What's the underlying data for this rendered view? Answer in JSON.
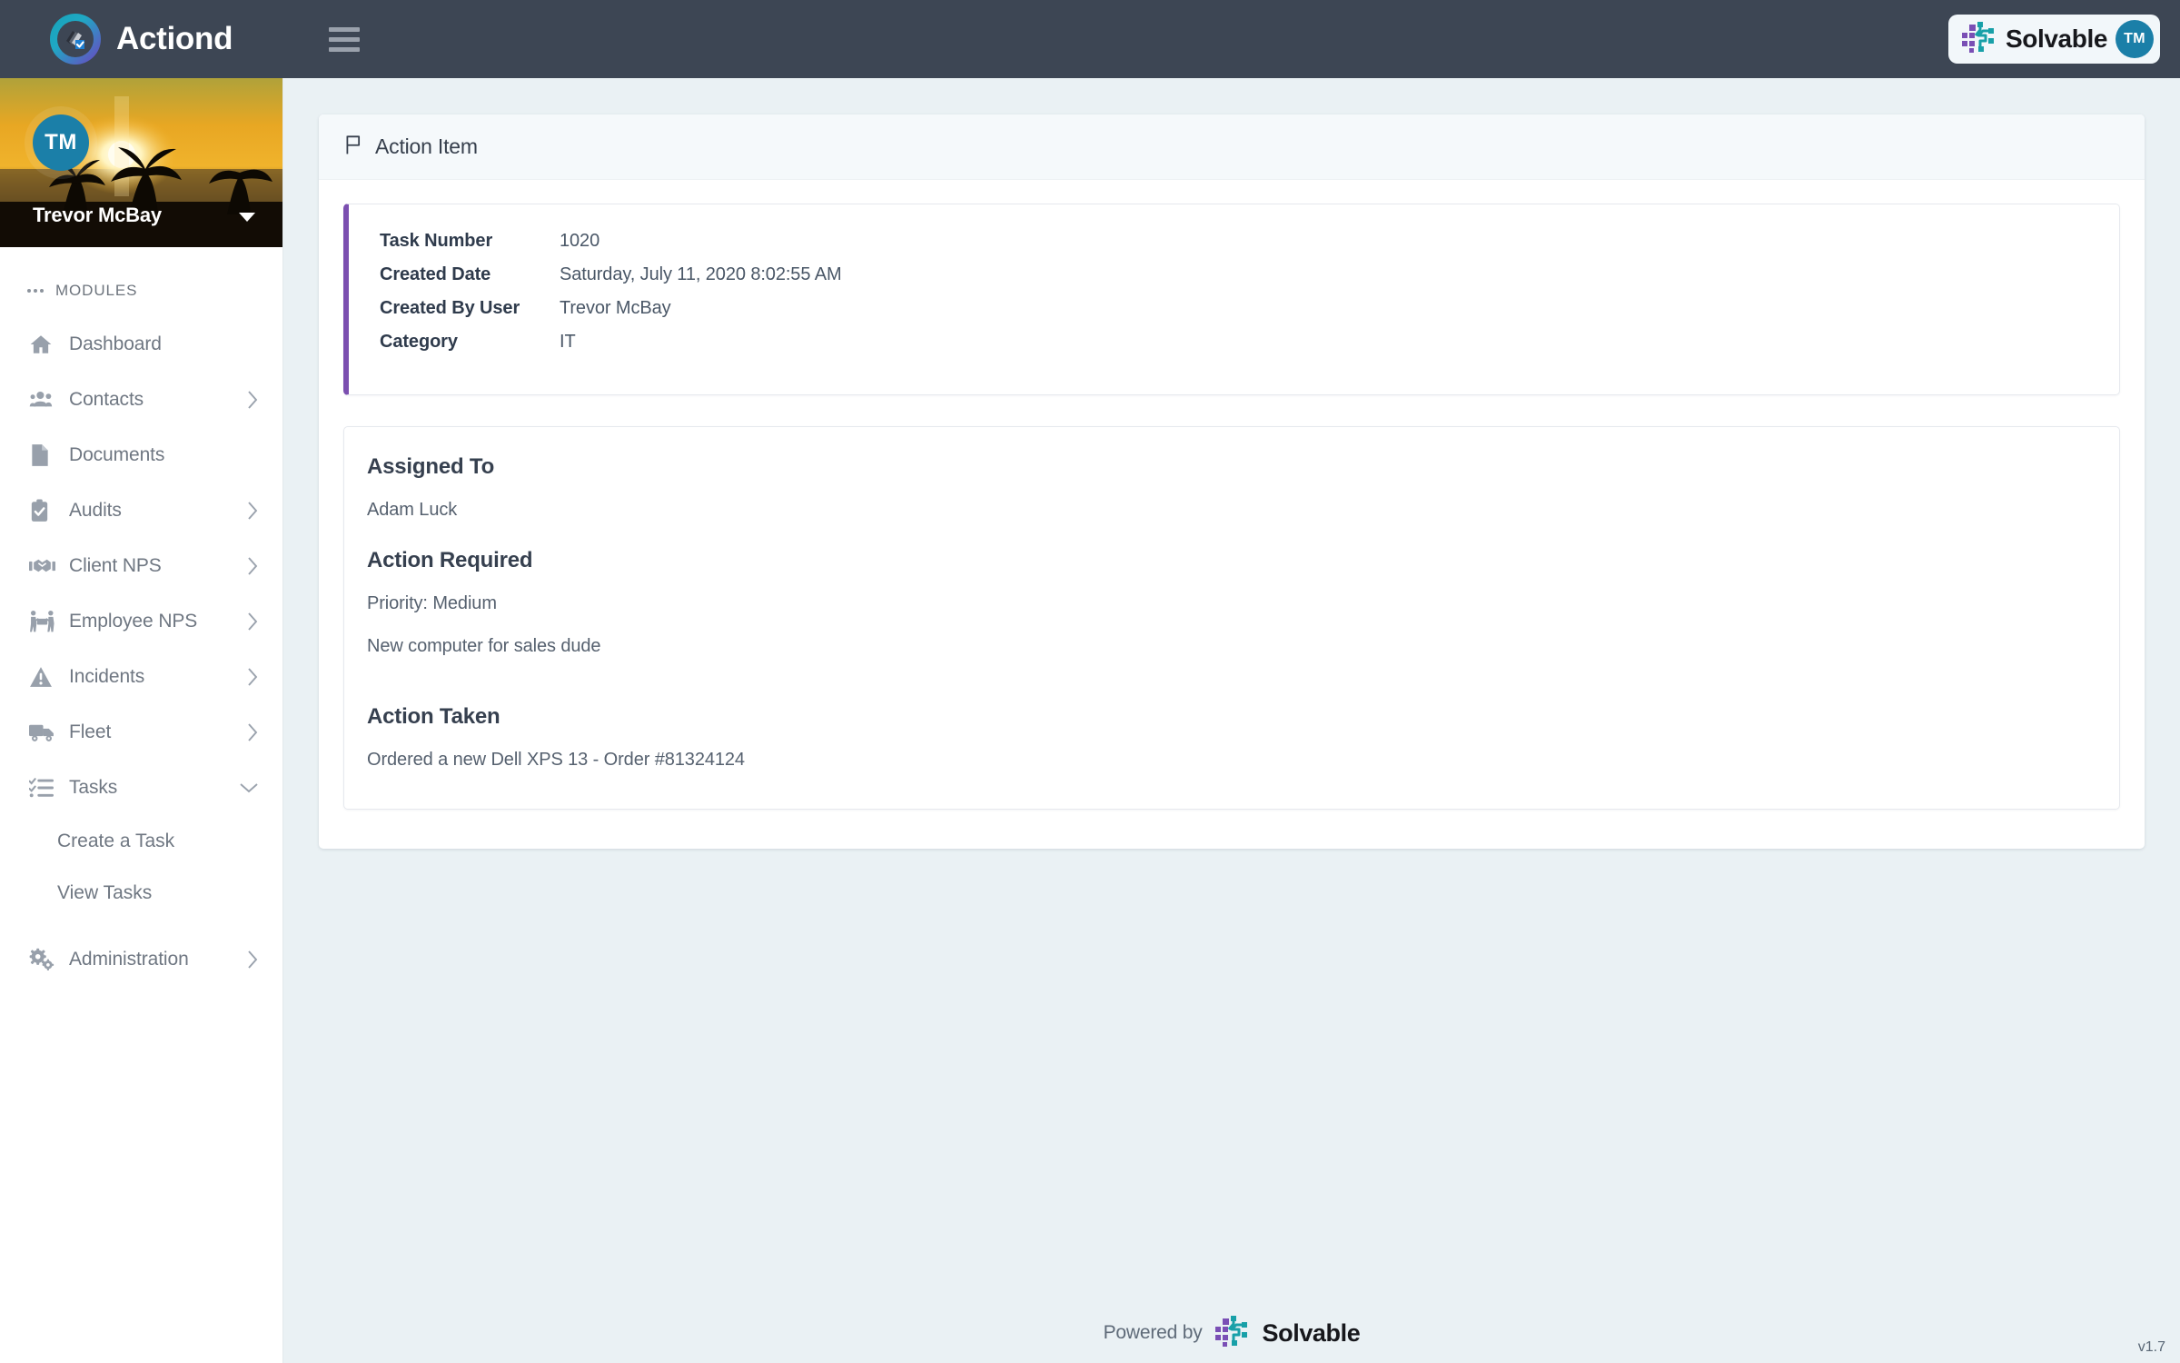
{
  "topbar": {
    "brand_name": "Actiond",
    "brand_logo_icon": "actiond-stacked-pages-check-logo",
    "menu_toggle_icon": "hamburger-menu-icon",
    "solvable": {
      "word": "Solvable",
      "logo_icon": "solvable-node-grid-logo",
      "tm_badge": "TM"
    }
  },
  "sidebar": {
    "profile": {
      "avatar_initials": "TM",
      "name": "Trevor McBay",
      "caret_icon": "caret-down-icon"
    },
    "section_label": "MODULES",
    "section_dots_icon": "ellipsis-icon",
    "items": [
      {
        "label": "Dashboard",
        "icon": "home-icon",
        "chevron": "",
        "expanded": false
      },
      {
        "label": "Contacts",
        "icon": "users-icon",
        "chevron": "›",
        "expanded": false
      },
      {
        "label": "Documents",
        "icon": "document-icon",
        "chevron": "",
        "expanded": false
      },
      {
        "label": "Audits",
        "icon": "clipboard-check-icon",
        "chevron": "›",
        "expanded": false
      },
      {
        "label": "Client NPS",
        "icon": "handshake-icon",
        "chevron": "›",
        "expanded": false
      },
      {
        "label": "Employee NPS",
        "icon": "people-carry-icon",
        "chevron": "›",
        "expanded": false
      },
      {
        "label": "Incidents",
        "icon": "warning-triangle-icon",
        "chevron": "›",
        "expanded": false
      },
      {
        "label": "Fleet",
        "icon": "truck-icon",
        "chevron": "›",
        "expanded": false
      },
      {
        "label": "Tasks",
        "icon": "task-list-icon",
        "chevron": "⌄",
        "expanded": true
      }
    ],
    "task_subitems": [
      {
        "label": "Create a Task"
      },
      {
        "label": "View Tasks"
      }
    ],
    "admin_item": {
      "label": "Administration",
      "icon": "gears-icon",
      "chevron": "›"
    }
  },
  "main": {
    "card_title": "Action Item",
    "card_title_icon": "flag-icon",
    "details": {
      "accent_color": "#7b4fb0",
      "rows": [
        {
          "key": "Task Number",
          "value": "1020"
        },
        {
          "key": "Created Date",
          "value": "Saturday, July 11, 2020 8:02:55 AM"
        },
        {
          "key": "Created By User",
          "value": "Trevor McBay"
        },
        {
          "key": "Category",
          "value": "IT"
        }
      ]
    },
    "sections": {
      "assigned_to_heading": "Assigned To",
      "assigned_to_value": "Adam Luck",
      "action_required_heading": "Action Required",
      "action_required_priority": "Priority: Medium",
      "action_required_body": "New computer for sales dude",
      "action_taken_heading": "Action Taken",
      "action_taken_body": "Ordered a new Dell XPS 13 - Order #81324124"
    }
  },
  "footer": {
    "powered_by": "Powered by",
    "solvable_word": "Solvable",
    "solvable_logo_icon": "solvable-node-grid-logo",
    "version": "v1.7"
  }
}
